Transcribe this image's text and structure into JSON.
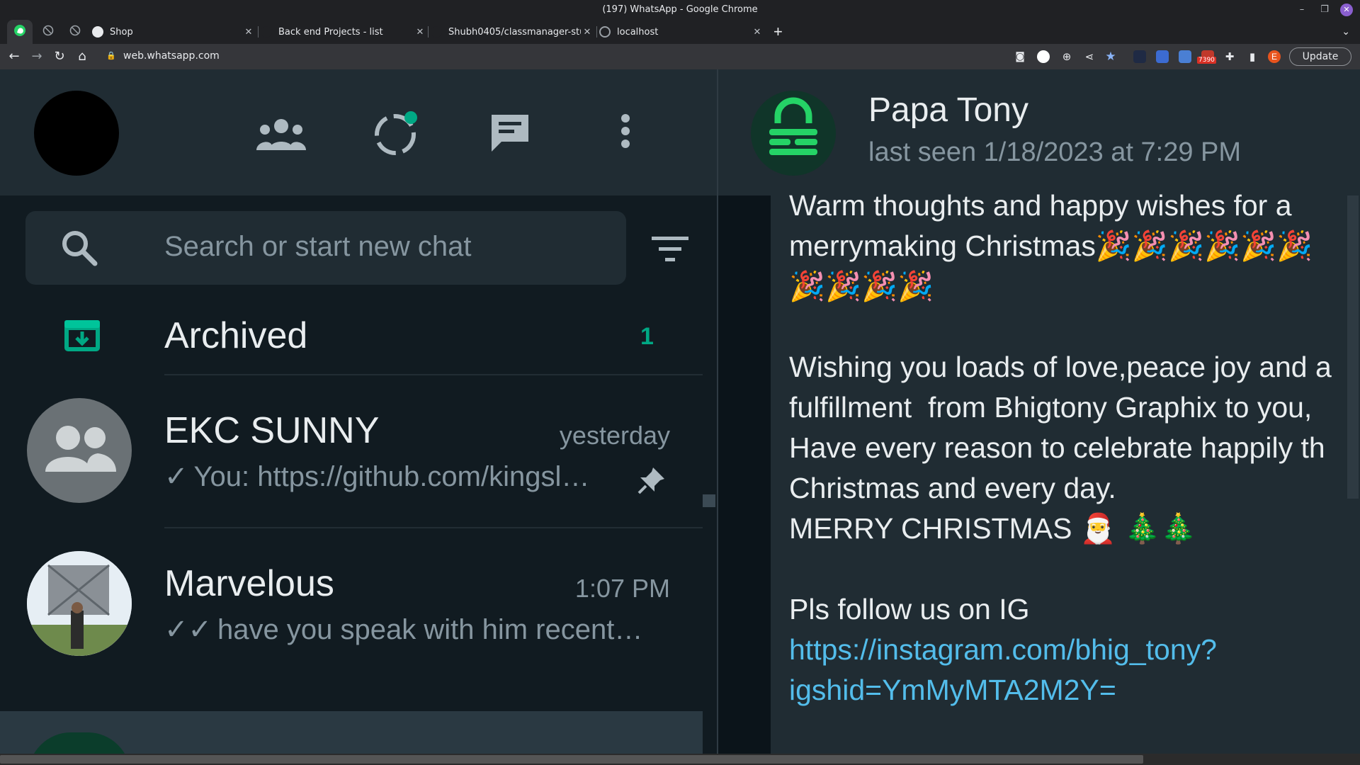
{
  "window": {
    "title": "(197) WhatsApp - Google Chrome",
    "minimize": "–",
    "restore": "❐",
    "close": "✕"
  },
  "tabs": [
    {
      "label": "Shop"
    },
    {
      "label": "Back end Projects - list"
    },
    {
      "label": "Shubh0405/classmanager-stu"
    },
    {
      "label": "localhost"
    }
  ],
  "tab_close": "✕",
  "new_tab": "+",
  "tab_search": "⌄",
  "address": {
    "url": "web.whatsapp.com"
  },
  "toolbar": {
    "update_label": "Update",
    "ext_badge": "7390",
    "profile_initial": "E"
  },
  "sidebar": {
    "search_placeholder": "Search or start new chat",
    "archived": {
      "label": "Archived",
      "count": "1"
    },
    "chats": [
      {
        "name": "EKC SUNNY",
        "time": "yesterday",
        "check": "✓",
        "preview": "You: https://github.com/kingsl…",
        "pinned": true
      },
      {
        "name": "Marvelous",
        "time": "1:07 PM",
        "check": "✓✓",
        "preview": "have you speak with him recent…"
      }
    ]
  },
  "conversation": {
    "contact_name": "Papa Tony",
    "status": "last seen 1/18/2023 at 7:29 PM",
    "message_lines": [
      "Warm thoughts and happy wishes for a",
      "merrymaking Christmas🎉🎉🎉🎉🎉🎉",
      "🎉🎉🎉🎉",
      "",
      "Wishing you loads of love,peace joy and a",
      "fulfillment  from Bhigtony Graphix to you,",
      "Have every reason to celebrate happily th",
      "Christmas and every day.",
      "MERRY CHRISTMAS 🎅 🎄🎄",
      "",
      "Pls follow us on IG"
    ],
    "link_line1": "https://instagram.com/bhig_tony?",
    "link_line2": "igshid=YmMyMTA2M2Y="
  },
  "colors": {
    "accent": "#00a884",
    "panel": "#202c33",
    "background": "#111b21",
    "link": "#53bdeb"
  }
}
